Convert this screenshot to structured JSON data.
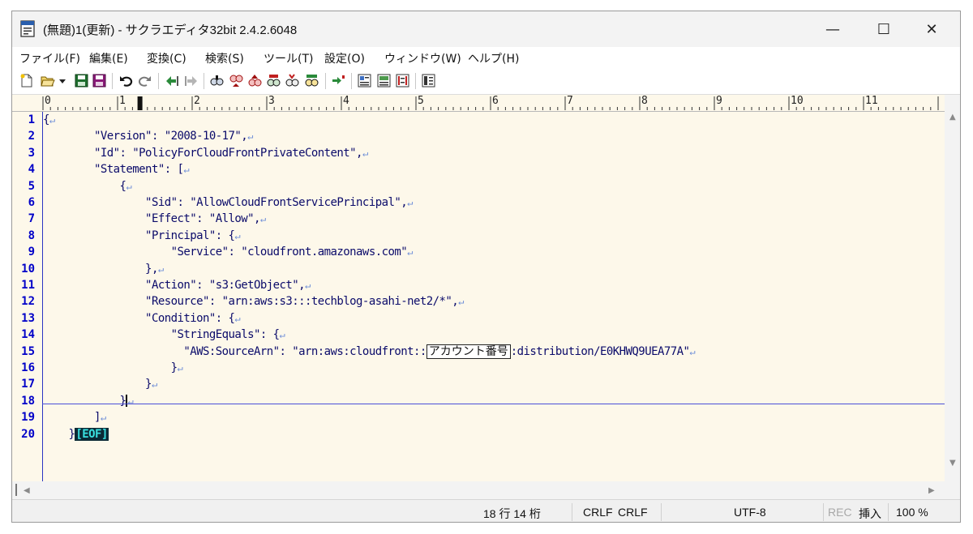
{
  "window": {
    "title": "(無題)1(更新) - サクラエディタ32bit 2.4.2.6048",
    "controls": {
      "minimize": "—",
      "maximize": "☐",
      "close": "✕"
    }
  },
  "menu": [
    "ファイル(F)",
    "編集(E)",
    "変換(C)",
    "検索(S)",
    "ツール(T)",
    "設定(O)",
    "ウィンドウ(W)",
    "ヘルプ(H)"
  ],
  "toolbar_icons": [
    "new-file-icon",
    "open-file-icon",
    "dropdown-icon",
    "save-icon",
    "save-all-icon",
    "undo-icon",
    "redo-icon",
    "jump-prev-icon",
    "jump-next-icon",
    "search-icon",
    "search-next-icon",
    "search-prev-icon",
    "replace-icon",
    "mark-icon",
    "grep-icon",
    "tag-jump-icon",
    "outline-icon",
    "compare-icon",
    "bracket-icon",
    "settings-icon"
  ],
  "ruler": {
    "labels": [
      "0",
      "1",
      "2",
      "3",
      "4",
      "5",
      "6",
      "7",
      "8",
      "9",
      "10",
      "11"
    ]
  },
  "editor": {
    "line_numbers": [
      "1",
      "2",
      "3",
      "4",
      "5",
      "6",
      "7",
      "8",
      "9",
      "10",
      "11",
      "12",
      "13",
      "14",
      "15",
      "16",
      "17",
      "18",
      "19",
      "20"
    ],
    "lines": [
      "{",
      "        \"Version\": \"2008-10-17\",",
      "        \"Id\": \"PolicyForCloudFrontPrivateContent\",",
      "        \"Statement\": [",
      "            {",
      "                \"Sid\": \"AllowCloudFrontServicePrincipal\",",
      "                \"Effect\": \"Allow\",",
      "                \"Principal\": {",
      "                    \"Service\": \"cloudfront.amazonaws.com\"",
      "                },",
      "                \"Action\": \"s3:GetObject\",",
      "                \"Resource\": \"arn:aws:s3:::techblog-asahi-net2/*\",",
      "                \"Condition\": {",
      "                    \"StringEquals\": {",
      "                      \"AWS:SourceArn\": \"arn:aws:cloudfront::",
      "                    }",
      "                }",
      "            }",
      "        ]",
      "    }"
    ],
    "line15_boxed": "アカウント番号",
    "line15_tail": ":distribution/E0KHWQ9UEA77A\"",
    "newline_mark": "↵",
    "eof_mark": "[EOF]"
  },
  "status": {
    "position": "18 行  14 桁",
    "eol1": "CRLF",
    "eol2": "CRLF",
    "encoding": "UTF-8",
    "rec": "REC",
    "insert": "挿入",
    "zoom": "100 %"
  }
}
